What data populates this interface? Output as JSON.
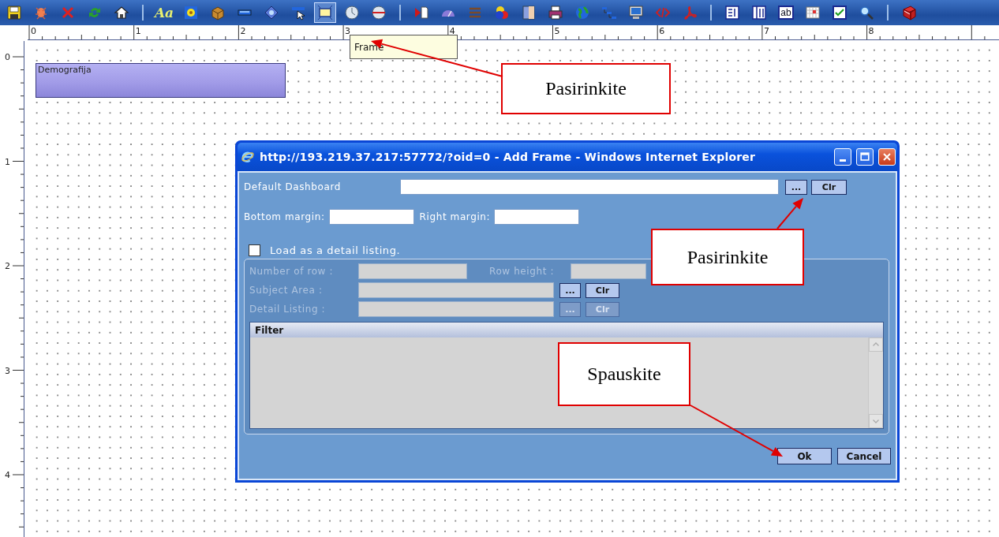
{
  "toolbar": {
    "groups": [
      {
        "buttons": [
          {
            "selected": false
          },
          {
            "selected": false
          },
          {
            "selected": false
          },
          {
            "selected": false
          },
          {
            "selected": false
          }
        ]
      },
      {
        "buttons": [
          {
            "label": "Aa",
            "selected": false
          },
          {
            "selected": false
          },
          {
            "selected": false
          },
          {
            "selected": false
          },
          {
            "selected": false
          },
          {
            "selected": false
          },
          {
            "selected": true
          },
          {
            "selected": false
          },
          {
            "selected": false
          }
        ]
      },
      {
        "buttons": [
          {
            "selected": false
          },
          {
            "selected": false
          },
          {
            "selected": false
          },
          {
            "selected": false
          },
          {
            "selected": false
          },
          {
            "selected": false
          },
          {
            "selected": false
          },
          {
            "selected": false
          },
          {
            "selected": false
          },
          {
            "selected": false
          },
          {
            "selected": false
          }
        ]
      },
      {
        "buttons": [
          {
            "selected": false
          },
          {
            "selected": false
          },
          {
            "label": "ab",
            "selected": false
          },
          {
            "selected": false
          },
          {
            "selected": false
          },
          {
            "selected": false
          }
        ]
      },
      {
        "buttons": [
          {
            "selected": false
          }
        ]
      }
    ]
  },
  "rulers": {
    "horizontal": [
      "0",
      "1",
      "2",
      "3",
      "4",
      "5",
      "6",
      "7",
      "8"
    ],
    "vertical": [
      "0",
      "1",
      "2",
      "3",
      "4"
    ]
  },
  "tooltip": {
    "text": "Frame"
  },
  "canvas": {
    "blocks": [
      {
        "title": "Demografija"
      }
    ]
  },
  "dialog": {
    "title": "http://193.219.37.217:57772/?oid=0 - Add Frame - Windows Internet Explorer",
    "default_dashboard": {
      "label": "Default Dashboard",
      "browse": "...",
      "clear": "Clr"
    },
    "bottom_margin": {
      "label": "Bottom margin:"
    },
    "right_margin": {
      "label": "Right margin:"
    },
    "detail_checkbox": {
      "label": "Load as a detail listing.",
      "checked": false
    },
    "detail_group": {
      "disabled": true,
      "number_of_row": {
        "label": "Number of row :"
      },
      "row_height": {
        "label": "Row height :"
      },
      "rows": [
        {
          "label": "Subject Area :",
          "browse": "...",
          "clear": "Clr",
          "disabled": false
        },
        {
          "label": "Detail Listing :",
          "browse": "...",
          "clear": "Clr",
          "disabled": true
        }
      ],
      "filter": {
        "title": "Filter"
      }
    },
    "buttons": [
      {
        "label": "Ok"
      },
      {
        "label": "Cancel"
      }
    ]
  },
  "annotations": [
    {
      "text": "Pasirinkite"
    },
    {
      "text": "Pasirinkite"
    },
    {
      "text": "Spauskite"
    }
  ]
}
